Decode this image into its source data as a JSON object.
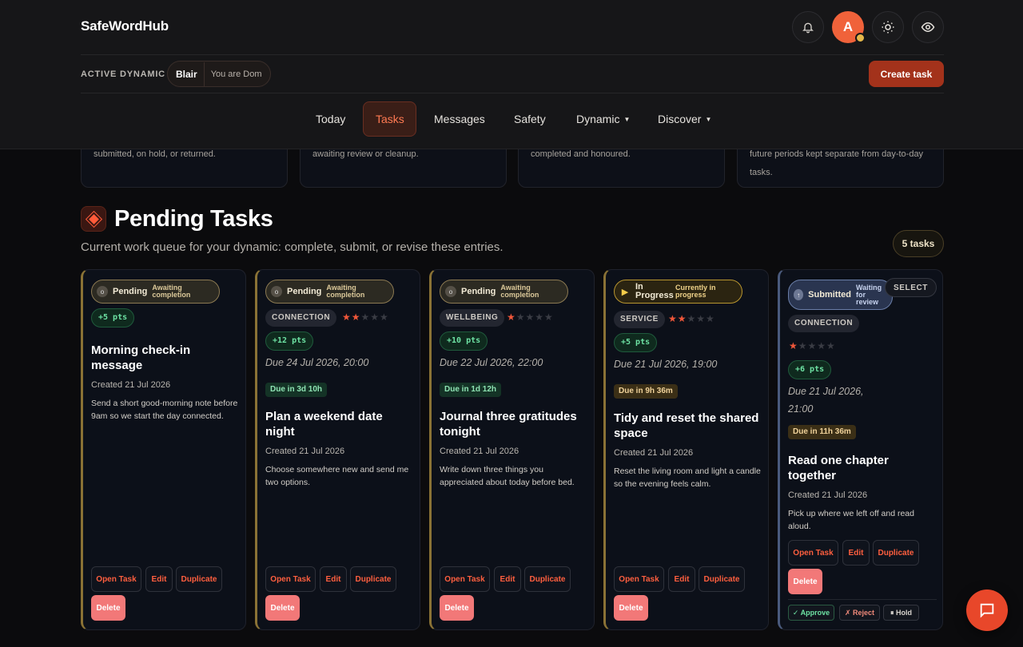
{
  "app": {
    "brand": "SafeWordHub",
    "avatar_initial": "A"
  },
  "header": {
    "active_label": "ACTIVE DYNAMIC",
    "partner": "Blair",
    "role": "You are Dom",
    "create_task": "Create task",
    "nav": [
      {
        "label": "Today"
      },
      {
        "label": "Tasks",
        "active": true
      },
      {
        "label": "Messages"
      },
      {
        "label": "Safety"
      },
      {
        "label": "Dynamic",
        "dropdown": true
      },
      {
        "label": "Discover",
        "dropdown": true
      }
    ]
  },
  "summary_cards": [
    {
      "text": "submitted, on hold, or returned."
    },
    {
      "text": "awaiting review or cleanup."
    },
    {
      "text": "completed and honoured."
    },
    {
      "text": "future periods kept separate from day-to-day tasks."
    }
  ],
  "section": {
    "title": "Pending Tasks",
    "subtitle": "Current work queue for your dynamic: complete, submit, or revise these entries.",
    "count": "5 tasks"
  },
  "tasks": [
    {
      "status": "Pending",
      "status_sub": "Awaiting completion",
      "category": "",
      "stars": 0,
      "points": "+5 pts",
      "due": "",
      "due_badge": "",
      "title": "Morning check-in message",
      "created": "Created 21 Jul 2026",
      "description": "Send a short good-morning note before 9am so we start the day connected."
    },
    {
      "status": "Pending",
      "status_sub": "Awaiting completion",
      "category": "CONNECTION",
      "stars": 2,
      "points": "+12 pts",
      "due": "Due 24 Jul 2026, 20:00",
      "due_badge": "Due in 3d 10h",
      "title": "Plan a weekend date night",
      "created": "Created 21 Jul 2026",
      "description": "Choose somewhere new and send me two options."
    },
    {
      "status": "Pending",
      "status_sub": "Awaiting completion",
      "category": "WELLBEING",
      "stars": 1,
      "points": "+10 pts",
      "due": "Due 22 Jul 2026, 22:00",
      "due_badge": "Due in 1d 12h",
      "title": "Journal three gratitudes tonight",
      "created": "Created 21 Jul 2026",
      "description": "Write down three things you appreciated about today before bed."
    },
    {
      "status": "In Progress",
      "status_sub": "Currently in progress",
      "category": "SERVICE",
      "stars": 2,
      "points": "+5 pts",
      "due": "Due 21 Jul 2026, 19:00",
      "due_badge": "Due in 9h 36m",
      "title": "Tidy and reset the shared space",
      "created": "Created 21 Jul 2026",
      "description": "Reset the living room and light a candle so the evening feels calm."
    },
    {
      "status": "Submitted",
      "status_sub": "Waiting for review",
      "category": "CONNECTION",
      "stars": 1,
      "points": "+6 pts",
      "due": "Due 21 Jul 2026, 21:00",
      "due_badge": "Due in 11h 36m",
      "title": "Read one chapter together",
      "created": "Created 21 Jul 2026",
      "description": "Pick up where we left off and read aloud.",
      "select_label": "SELECT"
    }
  ],
  "card_actions": {
    "open": "Open Task",
    "edit": "Edit",
    "duplicate": "Duplicate",
    "delete": "Delete"
  },
  "review_actions": {
    "approve": "✓ Approve",
    "reject": "✗ Reject",
    "hold": "⏸ Hold"
  },
  "colors": {
    "accent": "#ff5f3f",
    "create": "#a3321b",
    "points": "#6ee3a4",
    "star": "#f0573a"
  }
}
